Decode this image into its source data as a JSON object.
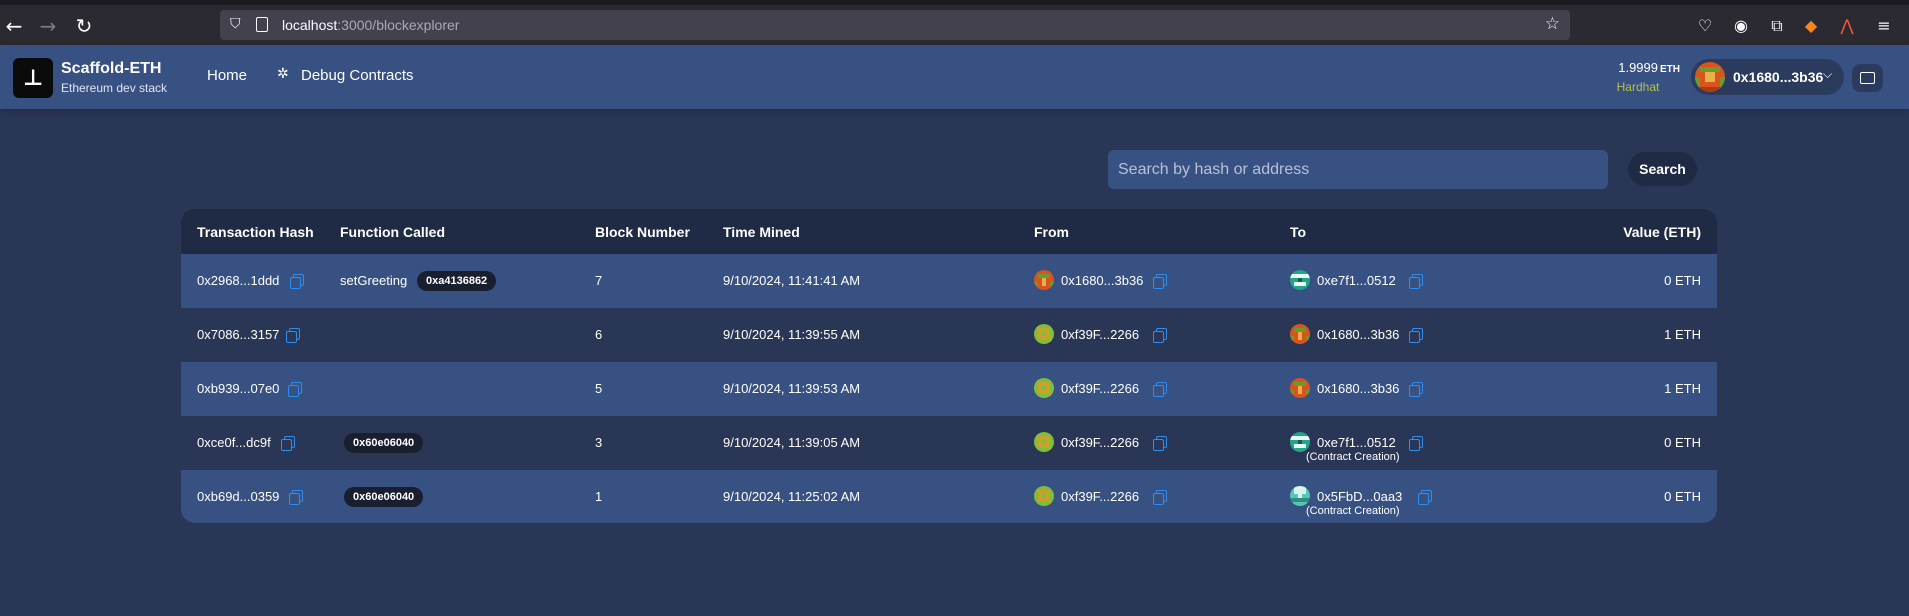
{
  "browser": {
    "url_host": "localhost",
    "url_rest": ":3000/blockexplorer"
  },
  "header": {
    "brand_title": "Scaffold-ETH",
    "brand_subtitle": "Ethereum dev stack",
    "nav": [
      {
        "label": "Home"
      },
      {
        "label": "Debug Contracts"
      }
    ],
    "balance_value": "1.9999",
    "balance_unit": "ETH",
    "network": "Hardhat",
    "account_address": "0x1680...3b36"
  },
  "search": {
    "placeholder": "Search by hash or address",
    "button_label": "Search"
  },
  "table": {
    "columns": [
      "Transaction Hash",
      "Function Called",
      "Block Number",
      "Time Mined",
      "From",
      "To",
      "Value (ETH)"
    ],
    "rows": [
      {
        "hash": "0x2968...1ddd",
        "function": "setGreeting",
        "selector": "0xa4136862",
        "block": "7",
        "time": "9/10/2024, 11:41:41 AM",
        "from": "0x1680...3b36",
        "to": "0xe7f1...0512",
        "to_note": "",
        "value": "0 ETH"
      },
      {
        "hash": "0x7086...3157",
        "function": "",
        "selector": "",
        "block": "6",
        "time": "9/10/2024, 11:39:55 AM",
        "from": "0xf39F...2266",
        "to": "0x1680...3b36",
        "to_note": "",
        "value": "1 ETH"
      },
      {
        "hash": "0xb939...07e0",
        "function": "",
        "selector": "",
        "block": "5",
        "time": "9/10/2024, 11:39:53 AM",
        "from": "0xf39F...2266",
        "to": "0x1680...3b36",
        "to_note": "",
        "value": "1 ETH"
      },
      {
        "hash": "0xce0f...dc9f",
        "function": "",
        "selector": "0x60e06040",
        "block": "3",
        "time": "9/10/2024, 11:39:05 AM",
        "from": "0xf39F...2266",
        "to": "0xe7f1...0512",
        "to_note": "(Contract Creation)",
        "value": "0 ETH"
      },
      {
        "hash": "0xb69d...0359",
        "function": "",
        "selector": "0x60e06040",
        "block": "1",
        "time": "9/10/2024, 11:25:02 AM",
        "from": "0xf39F...2266",
        "to": "0x5FbD...0aa3",
        "to_note": "(Contract Creation)",
        "value": "0 ETH"
      }
    ]
  },
  "colors": {
    "page_bg": "#2a3655",
    "header_bg": "#385183",
    "row_highlight": "#385183",
    "copy_icon": "#2a8ff0",
    "network": "#b4c245"
  }
}
